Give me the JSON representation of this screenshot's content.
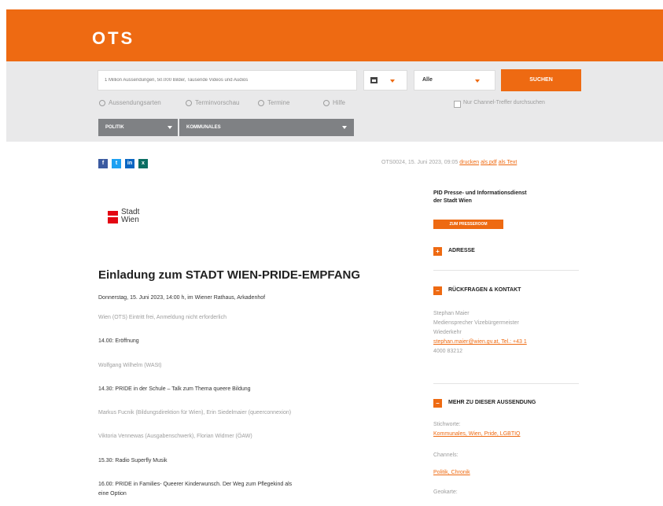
{
  "header": {
    "logo": "OTS"
  },
  "search": {
    "placeholder": "1 Million Aussendungen, 50.000 Bilder, Tausende Videos und Audios",
    "filter_value": "Alle",
    "button_label": "SUCHEN",
    "subnav": [
      "Aussendungsarten",
      "Terminvorschau",
      "Termine",
      "Hilfe"
    ],
    "checkbox_label": "Nur Channel-Treffer durchsuchen",
    "dropdowns": [
      "POLITIK",
      "KOMMUNALES"
    ]
  },
  "social": {
    "icons": [
      "facebook-icon",
      "twitter-icon",
      "linkedin-icon",
      "xing-icon"
    ]
  },
  "dateline": {
    "text": "OTS0024, 15. Juni 2023, 09:05",
    "links": [
      "drucken",
      "als pdf",
      "als Text"
    ]
  },
  "article": {
    "logo_lines": [
      "Stadt",
      "Wien"
    ],
    "headline": "Einladung zum STADT WIEN-PRIDE-EMPFANG",
    "paragraphs": [
      {
        "text": "Donnerstag, 15. Juni 2023, 14:00 h, im Wiener Rathaus, Arkadenhof",
        "style": "dark"
      },
      {
        "text": "Wien (OTS) Eintritt frei, Anmeldung nicht erforderlich",
        "style": "gray"
      },
      {
        "text": "14.00: Eröffnung",
        "style": "dark"
      },
      {
        "text": "Wolfgang Wilhelm (WASt)",
        "style": "gray"
      },
      {
        "text": "14.30: PRIDE in der Schule – Talk zum Thema queere Bildung",
        "style": "dark"
      },
      {
        "text": "Markus Fucnik (Bildungsdirektion für Wien), Erin Siedelmaier (queerconnexion)",
        "style": "gray"
      },
      {
        "text": "Viktoria Vennewas (Ausgabenschwerk), Florian Widmer (ÖAW)",
        "style": "gray"
      },
      {
        "text": "15.30: Radio Superfly Musik",
        "style": "dark"
      },
      {
        "text": "16.00: PRIDE in Families- Queerer Kinderwunsch. Der Weg zum Pflegekind als",
        "style": "dark"
      },
      {
        "text": "eine Option",
        "style": "dark"
      }
    ]
  },
  "sidebar": {
    "title_lines": [
      "PID Presse- und Informationsdienst",
      "der Stadt Wien"
    ],
    "newsroom_button": "ZUM PRESSEROOM",
    "sections": [
      {
        "label": "ADRESSE",
        "lines": []
      },
      {
        "label": "RÜCKFRAGEN & KONTAKT",
        "lines": [
          "Stephan Maier",
          "Mediensprecher Vizebürgermeister",
          "Wiederkehr",
          "stephan.maier@wien.gv.at, Tel.: +43 1",
          "4000 83212"
        ]
      },
      {
        "label": "MEHR ZU DIESER AUSSENDUNG",
        "lines": [
          "Stichworte:",
          "Kommunales, Wien, Pride, LGBTIQ",
          "Channels:",
          "Politik, Chronik",
          "Geokarte:"
        ]
      }
    ]
  },
  "colors": {
    "brand": "#ee6a12",
    "search_bg": "#e9e9ea",
    "filter_bg": "#7f8184"
  }
}
